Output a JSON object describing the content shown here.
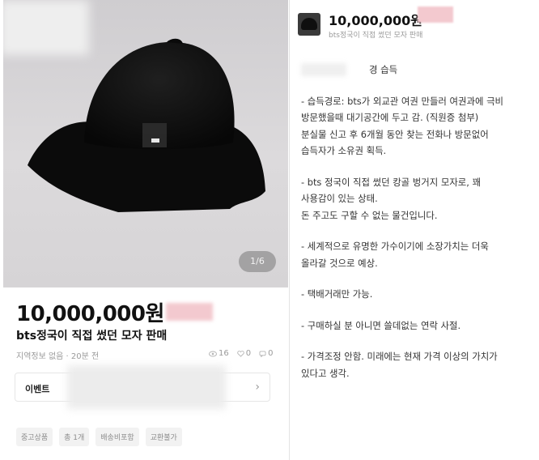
{
  "product": {
    "image_counter": "1/6",
    "price": "10,000,000원",
    "title": "bts정국이 직접 썼던 모자 판매",
    "meta": "지역정보 없음 · 20분 전",
    "stats": {
      "views": "16",
      "likes": "0",
      "chats": "0"
    },
    "event_label": "이벤트",
    "event_chevron": "›",
    "tags": [
      "중고상품",
      "총 1개",
      "배송비포함",
      "교환불가"
    ]
  },
  "header": {
    "price": "10,000,000원",
    "subtitle": "bts정국이 직접 썼던 모자 판매"
  },
  "description": {
    "lines": [
      "경 습득",
      "- 습득경로: bts가 외교관 여권 만들러 여권과에 극비",
      "방문했을때 대기공간에 두고 감. (직원증 첨부)",
      "분실물 신고 후 6개월 동안 찾는 전화나 방문없어",
      "습득자가 소유권 획득.",
      "- bts 정국이 직접 썼던 캉골 벙거지 모자로, 꽤",
      "사용감이 있는 상태.",
      "돈 주고도 구할 수 없는 물건입니다.",
      "- 세계적으로 유명한 가수이기에 소장가치는 더욱",
      "올라갈 것으로 예상.",
      "- 택배거래만 가능.",
      "- 구매하실 분 아니면 쓸데없는 연락 사절.",
      "- 가격조정 안함. 미래에는 현재 가격 이상의 가치가",
      "있다고 생각."
    ]
  },
  "icons": {
    "views": "eye-icon",
    "likes": "heart-icon",
    "chats": "chat-icon",
    "chevron": "chevron-right-icon"
  },
  "colors": {
    "price_blur": "#f3c9cf",
    "hat": "#121212",
    "accent_text": "#111111"
  }
}
